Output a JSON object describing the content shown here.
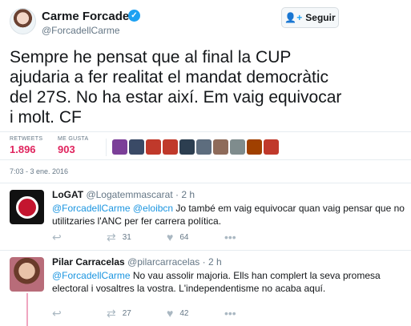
{
  "main_tweet": {
    "author_name": "Carme Forcadell",
    "author_handle": "@ForcadellCarme",
    "follow_label": "Seguir",
    "text": "Sempre he pensat que al final la CUP ajudaria a fer realitat el mandat democràtic del 27S. No ha estar així. Em vaig equivocar i molt. CF",
    "retweets_label": "RETWEETS",
    "retweets_count": "1.896",
    "likes_label": "ME GUSTA",
    "likes_count": "903",
    "timestamp": "7:03 - 3 ene. 2016",
    "likers_colors": [
      "#7b3f98",
      "#3a4a66",
      "#c0392b",
      "#c0392b",
      "#2c3e50",
      "#5d6d7e",
      "#8e6b5a",
      "#7f8c8d",
      "#a04000",
      "#c0392b"
    ]
  },
  "replies": [
    {
      "name": "LoGAT",
      "handle": "@Logatemmascarat",
      "time": "· 2 h",
      "mention": "@ForcadellCarme @eloibcn",
      "text": " Jo també em vaig equivocar quan vaig pensar que no utilitzaries l'ANC per fer carrera política.",
      "retweets": "31",
      "likes": "64"
    },
    {
      "name": "Pilar Carracelas",
      "handle": "@pilarcarracelas",
      "time": "· 2 h",
      "mention": "@ForcadellCarme",
      "text": " No vau assolir majoria. Ells han complert la seva promesa electoral i vosaltres la vostra. L'independentisme no acaba aquí.",
      "retweets": "27",
      "likes": "42"
    }
  ],
  "colors": {
    "accent": "#1da1f2",
    "like": "#e0245e",
    "mention": "#1b95e0"
  },
  "icons": {
    "reply": "reply-icon",
    "retweet": "retweet-icon",
    "like": "heart-icon",
    "more": "more-icon",
    "verified": "verified-icon",
    "follow": "add-user-icon"
  }
}
